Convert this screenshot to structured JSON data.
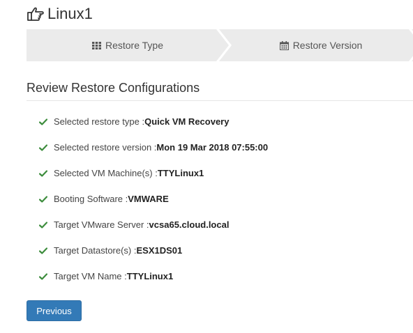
{
  "header": {
    "title": "Linux1",
    "icon": "hand-pointing-right-icon"
  },
  "wizard": {
    "steps": [
      {
        "label": "Restore Type",
        "icon": "grid-icon"
      },
      {
        "label": "Restore Version",
        "icon": "calendar-icon"
      }
    ]
  },
  "review": {
    "title": "Review Restore Configurations",
    "items": [
      {
        "label": "Selected restore type : ",
        "value": "Quick VM Recovery"
      },
      {
        "label": "Selected restore version : ",
        "value": "Mon 19 Mar 2018 07:55:00"
      },
      {
        "label": "Selected VM Machine(s) : ",
        "value": "TTYLinux1"
      },
      {
        "label": "Booting Software : ",
        "value": "VMWARE"
      },
      {
        "label": "Target VMware Server : ",
        "value": "vcsa65.cloud.local"
      },
      {
        "label": "Target Datastore(s) : ",
        "value": "ESX1DS01"
      },
      {
        "label": "Target VM Name : ",
        "value": "TTYLinux1"
      }
    ]
  },
  "actions": {
    "previous_label": "Previous"
  },
  "colors": {
    "check_green": "#3c8c3c",
    "primary_button": "#337ab7",
    "wizard_bg": "#ebebeb"
  }
}
